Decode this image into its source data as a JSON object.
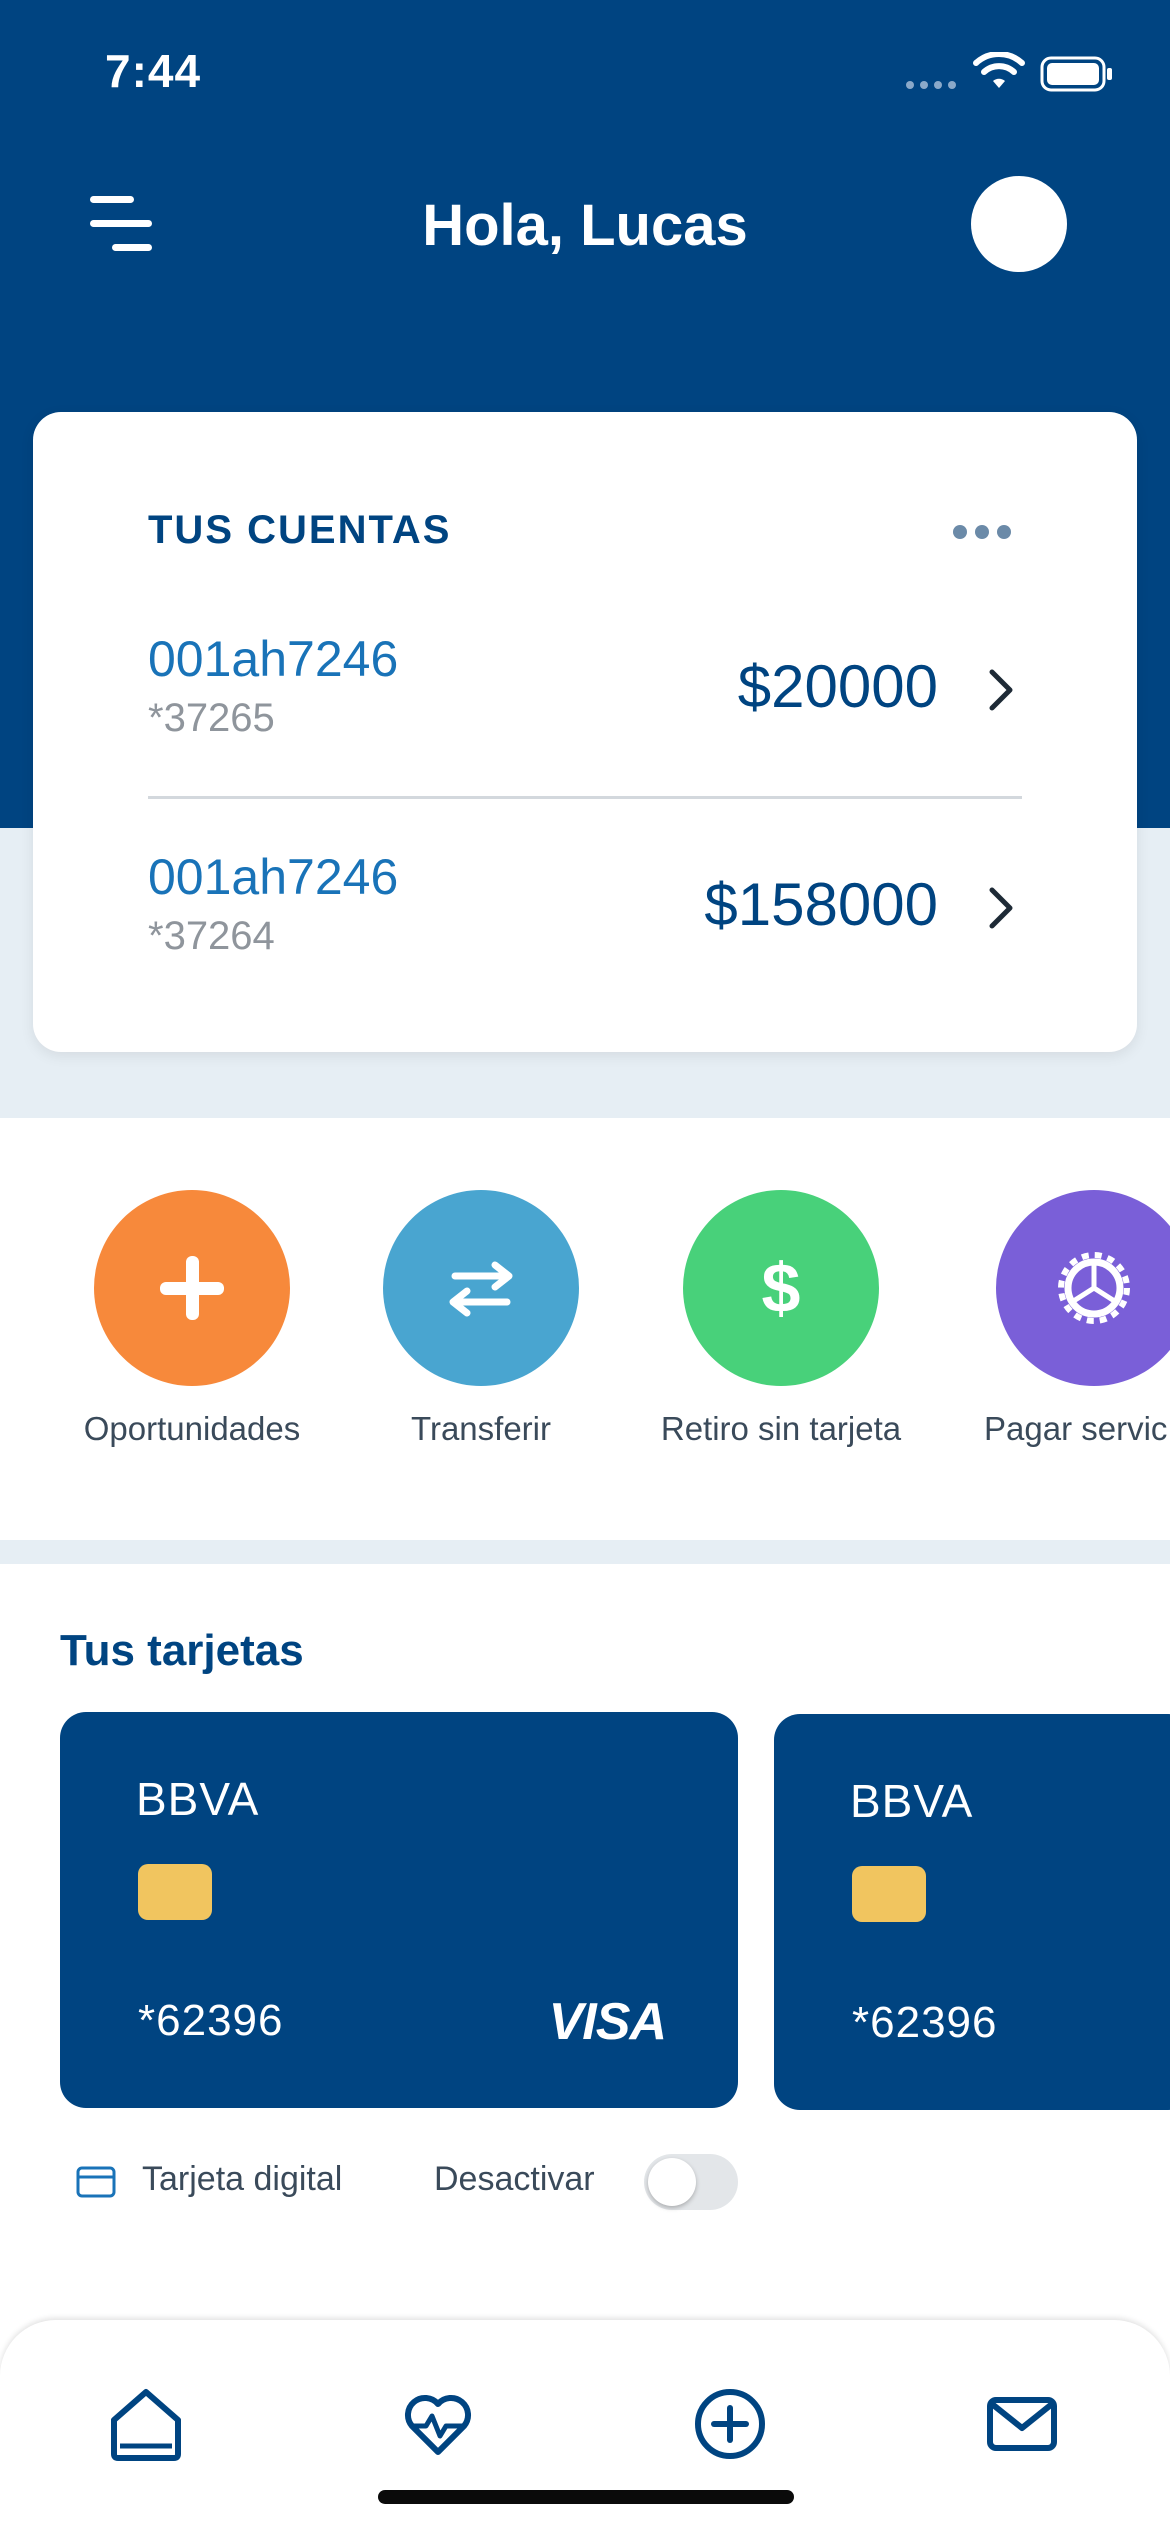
{
  "status_bar": {
    "time": "7:44"
  },
  "header": {
    "greeting": "Hola, Lucas"
  },
  "accounts": {
    "title": "TUS CUENTAS",
    "items": [
      {
        "name": "001ah7246",
        "number": "*37265",
        "amount": "$20000"
      },
      {
        "name": "001ah7246",
        "number": "*37264",
        "amount": "$158000"
      }
    ]
  },
  "quick_actions": [
    {
      "label": "Oportunidades",
      "icon": "plus-icon",
      "color": "#f7893b"
    },
    {
      "label": "Transferir",
      "icon": "transfer-arrows-icon",
      "color": "#49a5d0"
    },
    {
      "label": "Retiro sin tarjeta",
      "icon": "dollar-icon",
      "color": "#48d17a"
    },
    {
      "label": "Pagar servic",
      "icon": "gear-icon",
      "color": "#7a5fd8"
    }
  ],
  "cards": {
    "title": "Tus tarjetas",
    "items": [
      {
        "brand": "BBVA",
        "number": "*62396",
        "network": "VISA"
      },
      {
        "brand": "BBVA",
        "number": "*62396"
      }
    ],
    "digital_label": "Tarjeta digital",
    "deactivate_label": "Desactivar",
    "deactivate_on": false
  },
  "bottom_nav": [
    {
      "icon": "home-icon"
    },
    {
      "icon": "heart-pulse-icon"
    },
    {
      "icon": "plus-circle-icon"
    },
    {
      "icon": "mail-icon"
    }
  ],
  "colors": {
    "brand": "#004481",
    "link": "#1973b8",
    "background_light": "#e6eef4"
  }
}
